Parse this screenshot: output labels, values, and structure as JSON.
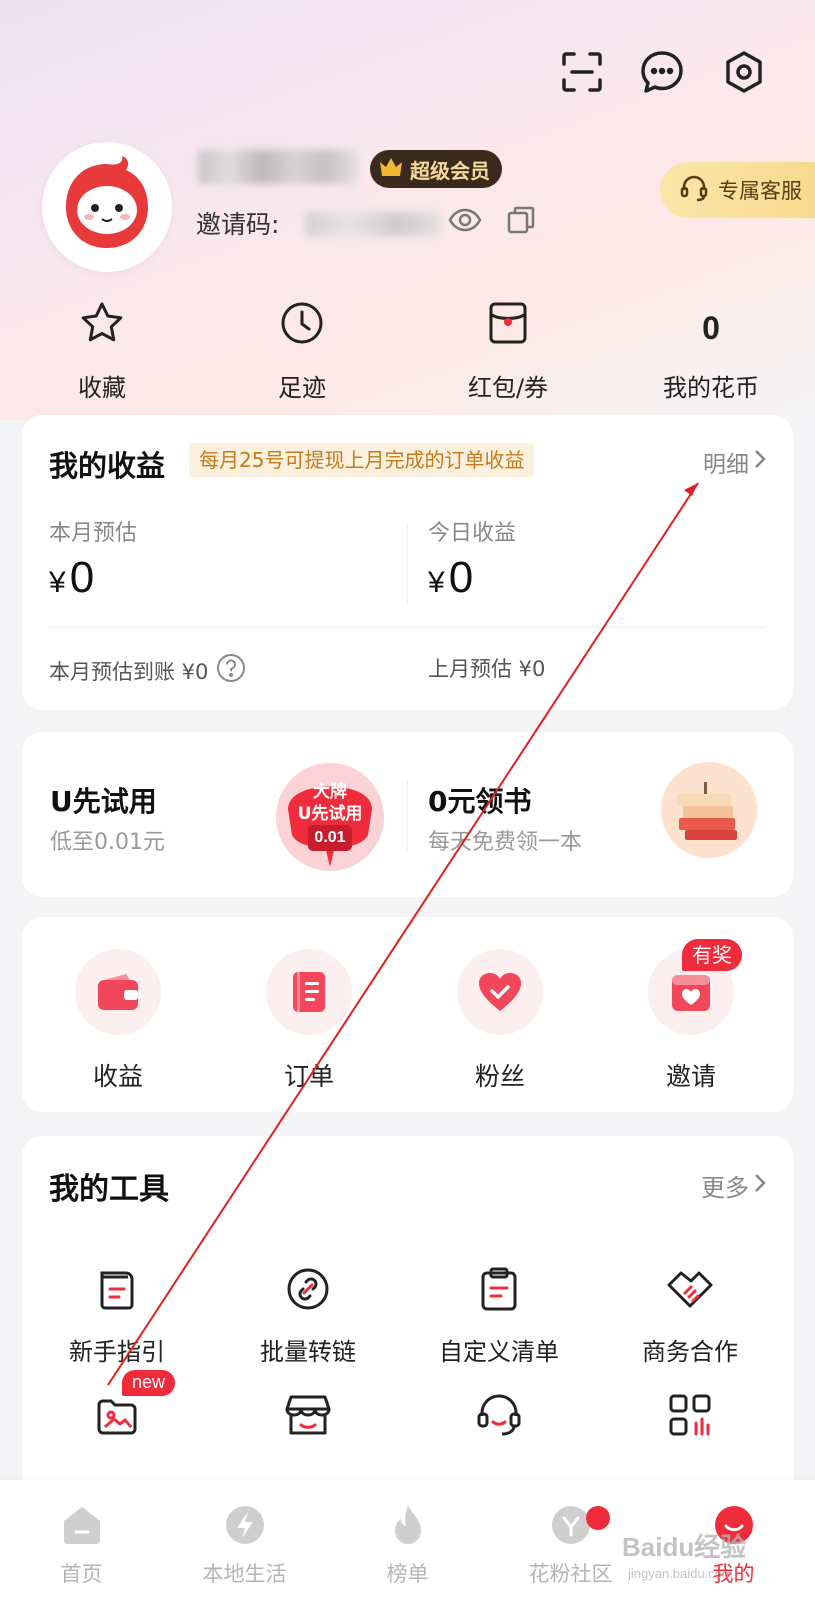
{
  "top_icons": [
    "scan-icon",
    "message-icon",
    "settings-icon"
  ],
  "profile": {
    "vip_label": "超级会员",
    "invite_label": "邀请码:",
    "service_label": "专属客服"
  },
  "shortcuts": [
    {
      "label": "收藏",
      "icon": "star-icon"
    },
    {
      "label": "足迹",
      "icon": "clock-icon"
    },
    {
      "label": "红包/券",
      "icon": "coupon-icon"
    },
    {
      "label": "我的花币",
      "value": "0"
    }
  ],
  "earnings": {
    "title": "我的收益",
    "note": "每月25号可提现上月完成的订单收益",
    "detail_label": "明细",
    "month_label": "本月预估",
    "month_value": "0",
    "today_label": "今日收益",
    "today_value": "0",
    "currency": "¥",
    "month_arrival": "本月预估到账 ¥0",
    "last_month": "上月预估 ¥0"
  },
  "promo": {
    "left_title": "U先试用",
    "left_sub": "低至0.01元",
    "left_img_text1": "大牌",
    "left_img_text2": "U先试用",
    "left_img_text3": "0.01",
    "right_title": "0元领书",
    "right_sub": "每天免费领一本"
  },
  "quick": [
    {
      "label": "收益",
      "icon": "wallet-icon"
    },
    {
      "label": "订单",
      "icon": "order-icon"
    },
    {
      "label": "粉丝",
      "icon": "heart-icon"
    },
    {
      "label": "邀请",
      "icon": "invite-icon"
    }
  ],
  "quick_badge": "有奖",
  "tools": {
    "title": "我的工具",
    "more_label": "更多",
    "items": [
      {
        "label": "新手指引",
        "icon": "guide-icon"
      },
      {
        "label": "批量转链",
        "icon": "link-icon"
      },
      {
        "label": "自定义清单",
        "icon": "clipboard-icon"
      },
      {
        "label": "商务合作",
        "icon": "handshake-icon"
      }
    ],
    "row2_icons": [
      "image-icon",
      "store-icon",
      "headset-icon",
      "grid-chart-icon"
    ],
    "new_badge": "new"
  },
  "bottom_nav": [
    {
      "label": "首页",
      "icon": "home-icon"
    },
    {
      "label": "本地生活",
      "icon": "lightning-icon"
    },
    {
      "label": "榜单",
      "icon": "flame-icon"
    },
    {
      "label": "花粉社区",
      "icon": "community-icon"
    },
    {
      "label": "我的",
      "icon": "profile-icon"
    }
  ],
  "watermark": "Baidu经验",
  "watermark_sub": "jingyan.baidu.com",
  "colors": {
    "accent": "#ef2b3c",
    "gold": "#f7d99a",
    "note_orange": "#c77a1a"
  }
}
